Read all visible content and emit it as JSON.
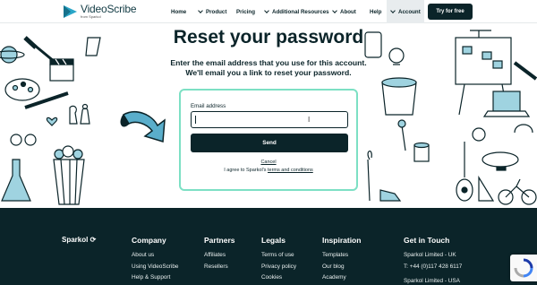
{
  "header": {
    "logo": {
      "name": "VideoScribe",
      "sub": "from Sparkol"
    },
    "nav": [
      {
        "label": "Home"
      },
      {
        "label": "Product"
      },
      {
        "label": "Pricing"
      },
      {
        "label": "Additional Resources"
      },
      {
        "label": "About"
      },
      {
        "label": "Help"
      },
      {
        "label": "Account"
      }
    ],
    "cta": "Try for free"
  },
  "main": {
    "title": "Reset your password",
    "subtitle_line1": "Enter the email address that you use for this account.",
    "subtitle_line2": "We'll email you a link to reset your password."
  },
  "form": {
    "email_label": "Email address",
    "email_value": "",
    "send_label": "Send",
    "cancel_label": "Cancel",
    "agree_prefix": "I agree to Sparkol's ",
    "agree_link": "terms and conditions"
  },
  "footer": {
    "brand": "Sparkol",
    "columns": [
      {
        "heading": "Company",
        "links": [
          "About us",
          "Using VideoScribe",
          "Help & Support"
        ]
      },
      {
        "heading": "Partners",
        "links": [
          "Affiliates",
          "Resellers"
        ]
      },
      {
        "heading": "Legals",
        "links": [
          "Terms of use",
          "Privacy policy",
          "Cookies"
        ]
      },
      {
        "heading": "Inspiration",
        "links": [
          "Templates",
          "Our blog",
          "Academy"
        ]
      },
      {
        "heading": "Get in Touch",
        "links": [
          "Sparkol Limited - UK",
          "T: +44 (0)117 428 6117",
          "Sparkol Limited - USA"
        ]
      }
    ]
  },
  "colors": {
    "navy": "#0b2429",
    "accent": "#7de0c4",
    "doodle_blue": "#9fd3e0"
  }
}
